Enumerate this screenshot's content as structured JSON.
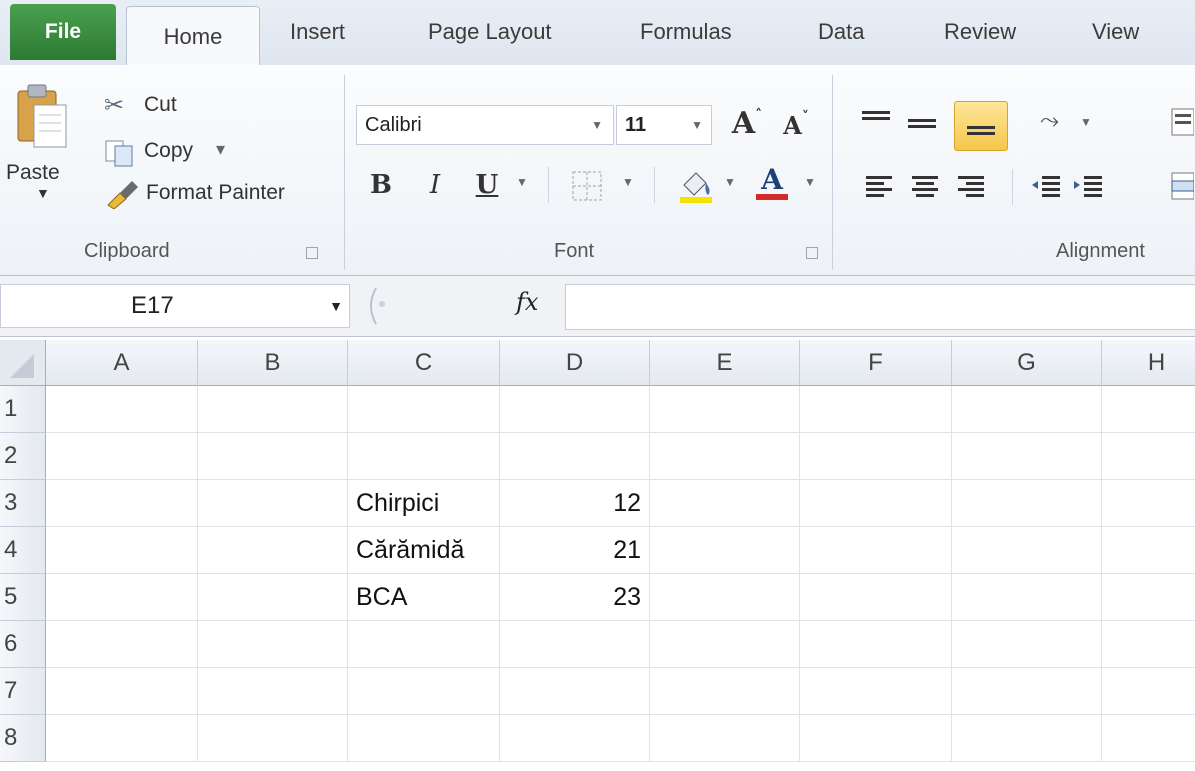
{
  "tabs": [
    "File",
    "Home",
    "Insert",
    "Page Layout",
    "Formulas",
    "Data",
    "Review",
    "View"
  ],
  "clipboard": {
    "paste": "Paste",
    "cut": "Cut",
    "copy": "Copy",
    "copy_arrow": "▾",
    "format_painter": "Format Painter",
    "group_label": "Clipboard"
  },
  "font": {
    "family": "Calibri",
    "size": "11",
    "bold": "B",
    "italic": "I",
    "underline": "U",
    "font_color": "A",
    "grow": "A",
    "shrink": "A",
    "group_label": "Font",
    "highlight_color": "#f5e400",
    "text_color": "#d32b2b"
  },
  "alignment": {
    "group_label": "Alignment"
  },
  "formula_bar": {
    "name_box": "E17",
    "fx": "fx",
    "content": ""
  },
  "sheet": {
    "columns": [
      "A",
      "B",
      "C",
      "D",
      "E",
      "F",
      "G",
      "H"
    ],
    "rows": [
      "1",
      "2",
      "3",
      "4",
      "5",
      "6",
      "7",
      "8"
    ],
    "cells": [
      {
        "row": 3,
        "col": "C",
        "value": "Chirpici"
      },
      {
        "row": 3,
        "col": "D",
        "value": "12"
      },
      {
        "row": 4,
        "col": "C",
        "value": "Cărămidă"
      },
      {
        "row": 4,
        "col": "D",
        "value": "21"
      },
      {
        "row": 5,
        "col": "C",
        "value": "BCA"
      },
      {
        "row": 5,
        "col": "D",
        "value": "23"
      }
    ]
  },
  "colors": {
    "file_tab": "#2d7a33",
    "active_align": "#f5c64a"
  }
}
